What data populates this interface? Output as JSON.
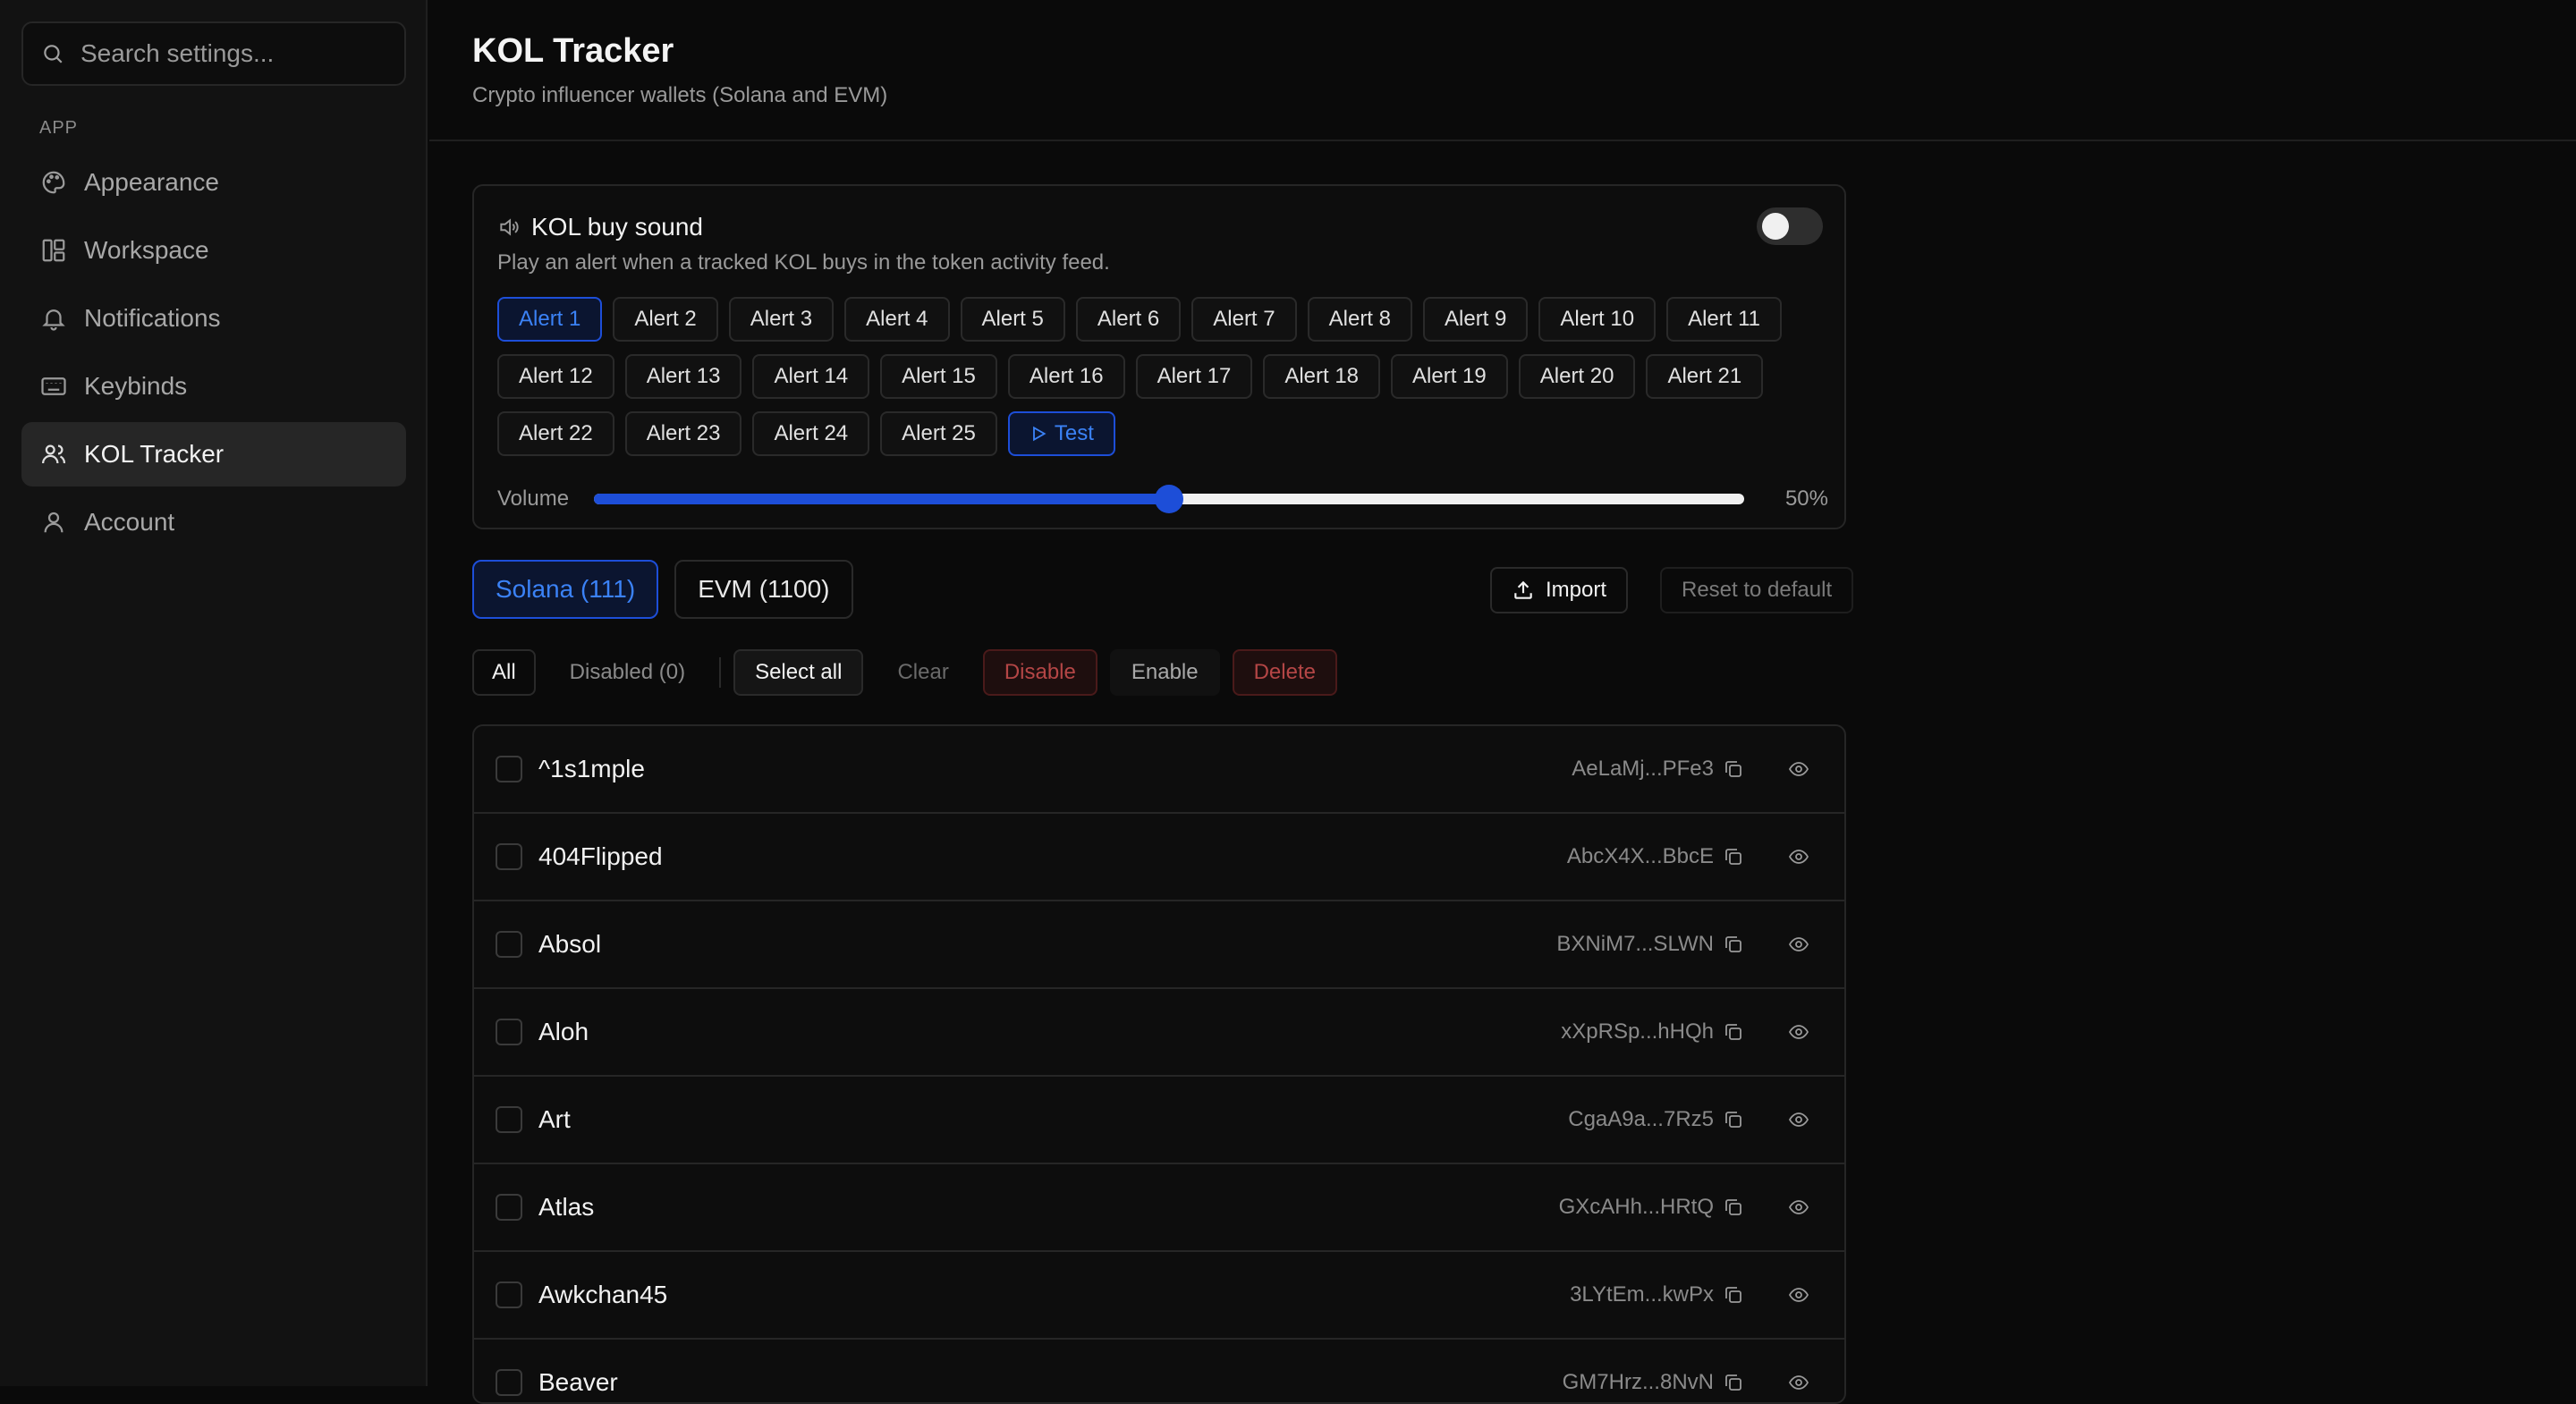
{
  "search": {
    "placeholder": "Search settings..."
  },
  "sidebar": {
    "section_label": "APP",
    "items": [
      {
        "label": "Appearance",
        "icon": "palette-icon"
      },
      {
        "label": "Workspace",
        "icon": "layout-icon"
      },
      {
        "label": "Notifications",
        "icon": "bell-icon"
      },
      {
        "label": "Keybinds",
        "icon": "keyboard-icon"
      },
      {
        "label": "KOL Tracker",
        "icon": "users-icon",
        "active": true
      },
      {
        "label": "Account",
        "icon": "user-icon"
      }
    ]
  },
  "header": {
    "title": "KOL Tracker",
    "subtitle": "Crypto influencer wallets (Solana and EVM)"
  },
  "sound": {
    "title": "KOL buy sound",
    "description": "Play an alert when a tracked KOL buys in the token activity feed.",
    "enabled": false,
    "alerts": [
      "Alert 1",
      "Alert 2",
      "Alert 3",
      "Alert 4",
      "Alert 5",
      "Alert 6",
      "Alert 7",
      "Alert 8",
      "Alert 9",
      "Alert 10",
      "Alert 11",
      "Alert 12",
      "Alert 13",
      "Alert 14",
      "Alert 15",
      "Alert 16",
      "Alert 17",
      "Alert 18",
      "Alert 19",
      "Alert 20",
      "Alert 21",
      "Alert 22",
      "Alert 23",
      "Alert 24",
      "Alert 25"
    ],
    "selected_alert": "Alert 1",
    "test_label": "Test",
    "volume_label": "Volume",
    "volume_value": "50%",
    "volume_fraction": 0.5
  },
  "chains": {
    "tabs": [
      {
        "label": "Solana (111)",
        "active": true
      },
      {
        "label": "EVM (1100)",
        "active": false
      }
    ],
    "import_label": "Import",
    "reset_label": "Reset to default"
  },
  "filters": {
    "all": "All",
    "disabled": "Disabled (0)",
    "select_all": "Select all",
    "clear": "Clear",
    "disable": "Disable",
    "enable": "Enable",
    "delete": "Delete"
  },
  "kols": [
    {
      "name": "^1s1mple",
      "address": "AeLaMj...PFe3"
    },
    {
      "name": "404Flipped",
      "address": "AbcX4X...BbcE"
    },
    {
      "name": "Absol",
      "address": "BXNiM7...SLWN"
    },
    {
      "name": "Aloh",
      "address": "xXpRSp...hHQh"
    },
    {
      "name": "Art",
      "address": "CgaA9a...7Rz5"
    },
    {
      "name": "Atlas",
      "address": "GXcAHh...HRtQ"
    },
    {
      "name": "Awkchan45",
      "address": "3LYtEm...kwPx"
    },
    {
      "name": "Beaver",
      "address": "GM7Hrz...8NvN"
    }
  ],
  "colors": {
    "accent": "#1d4ed8",
    "accent_text": "#3b82f6",
    "danger": "#b44646"
  }
}
